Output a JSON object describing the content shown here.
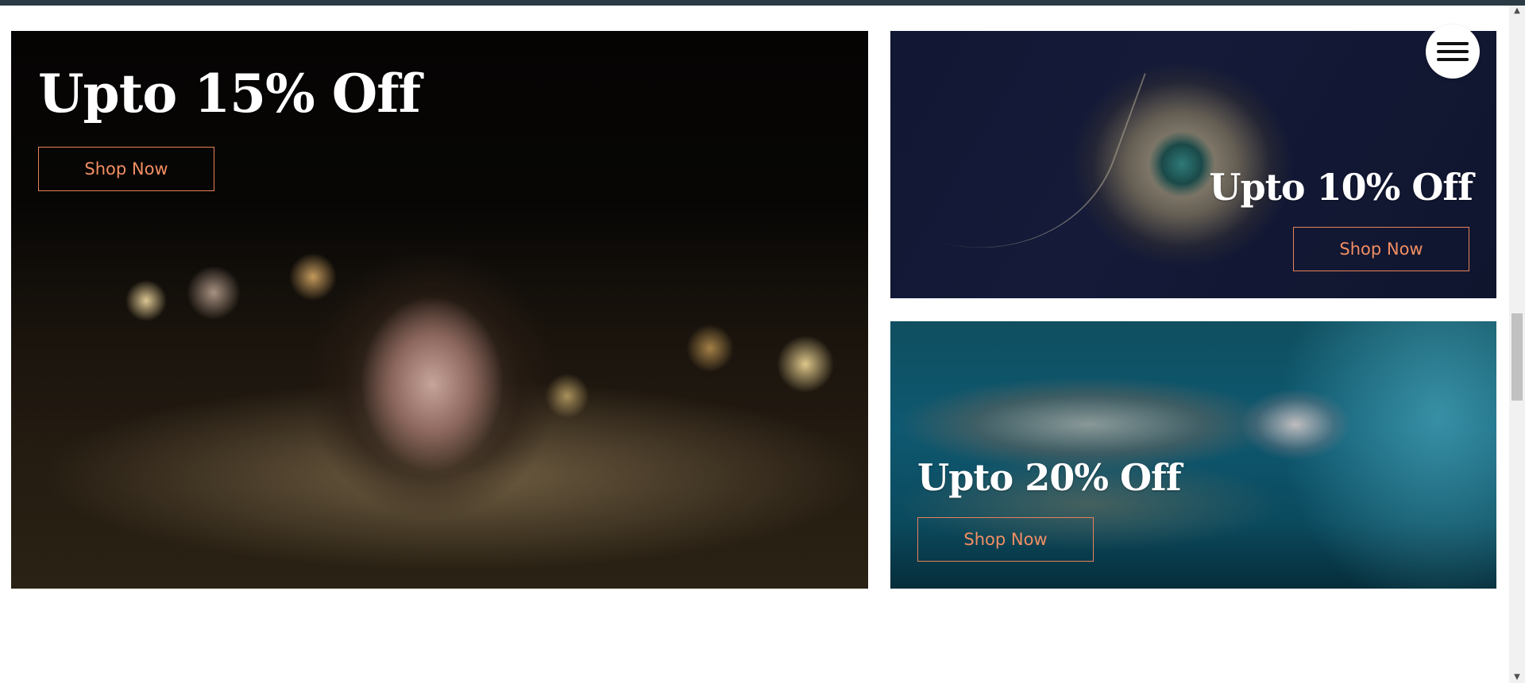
{
  "banners": [
    {
      "title": "Upto 15% Off",
      "button_label": "Shop Now"
    },
    {
      "title": "Upto 10% Off",
      "button_label": "Shop Now"
    },
    {
      "title": "Upto 20% Off",
      "button_label": "Shop Now"
    }
  ],
  "menu": {
    "icon": "hamburger-menu-icon"
  },
  "scrollbar": {
    "up_arrow": "▲",
    "down_arrow": "▼"
  },
  "colors": {
    "accent": "#f28e63",
    "topbar": "#2b3a44",
    "title_text": "#ffffff"
  }
}
